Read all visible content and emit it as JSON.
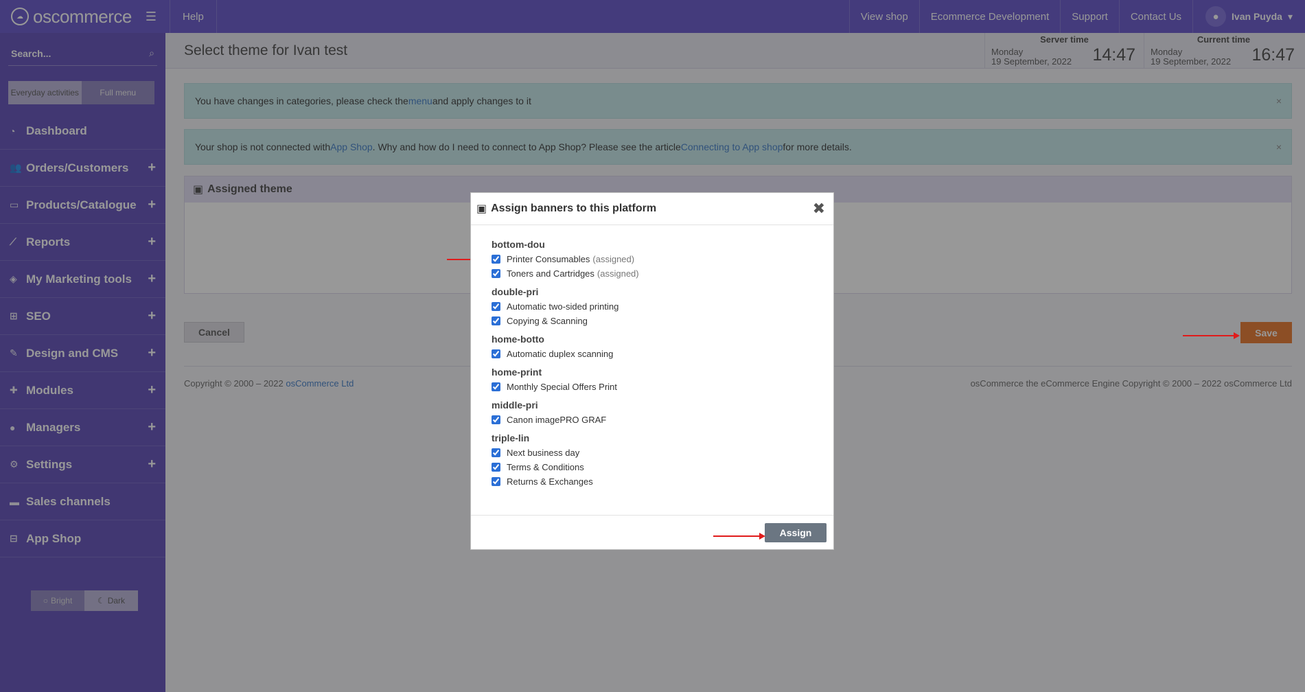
{
  "topbar": {
    "brand": "oscommerce",
    "help": "Help",
    "links": [
      "View shop",
      "Ecommerce Development",
      "Support",
      "Contact Us"
    ],
    "user": "Ivan Puyda"
  },
  "sidebar": {
    "search_placeholder": "Search...",
    "mode_everyday": "Everyday activities",
    "mode_full": "Full menu",
    "items": [
      {
        "label": "Dashboard",
        "icon": "dashboard-icon"
      },
      {
        "label": "Orders/Customers",
        "icon": "users-icon"
      },
      {
        "label": "Products/Catalogue",
        "icon": "folder-icon"
      },
      {
        "label": "Reports",
        "icon": "chart-icon"
      },
      {
        "label": "My Marketing tools",
        "icon": "tag-icon"
      },
      {
        "label": "SEO",
        "icon": "sitemap-icon"
      },
      {
        "label": "Design and CMS",
        "icon": "brush-icon"
      },
      {
        "label": "Modules",
        "icon": "puzzle-icon"
      },
      {
        "label": "Managers",
        "icon": "user-icon"
      },
      {
        "label": "Settings",
        "icon": "gears-icon"
      },
      {
        "label": "Sales channels",
        "icon": "desktop-icon"
      },
      {
        "label": "App Shop",
        "icon": "cart-icon"
      }
    ],
    "theme_bright": "Bright",
    "theme_dark": "Dark"
  },
  "header": {
    "title": "Select theme for Ivan test",
    "server_time": {
      "label": "Server time",
      "day": "Monday",
      "date": "19 September, 2022",
      "time": "14:47"
    },
    "current_time": {
      "label": "Current time",
      "day": "Monday",
      "date": "19 September, 2022",
      "time": "16:47"
    }
  },
  "alerts": {
    "a1_pre": "You have changes in categories, please check the ",
    "a1_link": "menu",
    "a1_post": " and apply changes to it",
    "a2_pre": "Your shop is not connected with ",
    "a2_link1": "App Shop",
    "a2_mid": ". Why and how do I need to connect to App Shop? Please see the article ",
    "a2_link2": "Connecting to App shop",
    "a2_post": " for more details.",
    "close": "×"
  },
  "panel": {
    "title": "Assigned theme"
  },
  "buttons": {
    "cancel": "Cancel",
    "save": "Save"
  },
  "footer": {
    "left_pre": "Copyright © 2000 – 2022 ",
    "left_link": "osCommerce Ltd",
    "right": "osCommerce the eCommerce Engine Copyright © 2000 – 2022 osCommerce Ltd"
  },
  "modal": {
    "title": "Assign banners to this platform",
    "close": "✖",
    "assign": "Assign",
    "groups": [
      {
        "title": "bottom-dou",
        "items": [
          {
            "label": "Printer Consumables",
            "note": "(assigned)",
            "checked": true
          },
          {
            "label": "Toners and Cartridges",
            "note": "(assigned)",
            "checked": true
          }
        ]
      },
      {
        "title": "double-pri",
        "items": [
          {
            "label": "Automatic two-sided printing",
            "note": "",
            "checked": true
          },
          {
            "label": "Copying & Scanning",
            "note": "",
            "checked": true
          }
        ]
      },
      {
        "title": "home-botto",
        "items": [
          {
            "label": "Automatic duplex scanning",
            "note": "",
            "checked": true
          }
        ]
      },
      {
        "title": "home-print",
        "items": [
          {
            "label": "Monthly Special Offers Print",
            "note": "",
            "checked": true
          }
        ]
      },
      {
        "title": "middle-pri",
        "items": [
          {
            "label": "Canon imagePRO GRAF",
            "note": "",
            "checked": true
          }
        ]
      },
      {
        "title": "triple-lin",
        "items": [
          {
            "label": "Next business day",
            "note": "",
            "checked": true
          },
          {
            "label": "Terms & Conditions",
            "note": "",
            "checked": true
          },
          {
            "label": "Returns & Exchanges",
            "note": "",
            "checked": true
          }
        ]
      }
    ]
  },
  "colors": {
    "topbar": "#5e4ec9",
    "sidebar": "#5846b7",
    "save": "#e87224",
    "assign": "#6b7682",
    "annotation_arrow": "#e01b1b"
  }
}
